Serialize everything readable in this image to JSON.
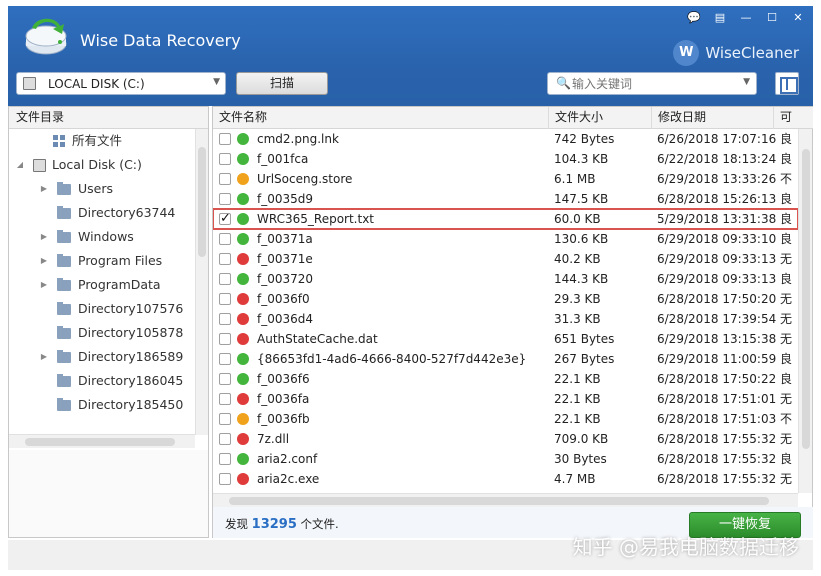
{
  "app": {
    "title": "Wise Data Recovery",
    "brand": "WiseCleaner",
    "brand_mark": "W"
  },
  "window_buttons": [
    "💬",
    "▤",
    "—",
    "☐",
    "✕"
  ],
  "toolbar": {
    "disk": "LOCAL DISK (C:)",
    "scan_label": "扫描",
    "search_placeholder": "输入关键词"
  },
  "sidebar": {
    "header": "文件目录",
    "items": [
      {
        "label": "所有文件",
        "type": "all",
        "indent": 1,
        "expander": ""
      },
      {
        "label": "Local Disk (C:)",
        "type": "disk",
        "indent": 0,
        "expander": "◢"
      },
      {
        "label": "Users",
        "type": "folder",
        "indent": 2,
        "expander": "▶"
      },
      {
        "label": "Directory63744",
        "type": "folder",
        "indent": 2,
        "expander": ""
      },
      {
        "label": "Windows",
        "type": "folder",
        "indent": 2,
        "expander": "▶"
      },
      {
        "label": "Program Files",
        "type": "folder",
        "indent": 2,
        "expander": "▶"
      },
      {
        "label": "ProgramData",
        "type": "folder",
        "indent": 2,
        "expander": "▶"
      },
      {
        "label": "Directory107576",
        "type": "folder",
        "indent": 2,
        "expander": ""
      },
      {
        "label": "Directory105878",
        "type": "folder",
        "indent": 2,
        "expander": ""
      },
      {
        "label": "Directory186589",
        "type": "folder",
        "indent": 2,
        "expander": "▶"
      },
      {
        "label": "Directory186045",
        "type": "folder",
        "indent": 2,
        "expander": ""
      },
      {
        "label": "Directory185450",
        "type": "folder",
        "indent": 2,
        "expander": ""
      }
    ]
  },
  "table": {
    "columns": [
      "文件名称",
      "文件大小",
      "修改日期",
      "可"
    ],
    "rows": [
      {
        "name": "cmd2.png.lnk",
        "size": "742 Bytes",
        "date": "6/26/2018 17:07:16",
        "flag": "良",
        "status": "good",
        "checked": false
      },
      {
        "name": "f_001fca",
        "size": "104.3 KB",
        "date": "6/22/2018 18:13:24",
        "flag": "良",
        "status": "good",
        "checked": false
      },
      {
        "name": "UrlSoceng.store",
        "size": "6.1 MB",
        "date": "6/29/2018 13:33:26",
        "flag": "不",
        "status": "fair",
        "checked": false
      },
      {
        "name": "f_0035d9",
        "size": "147.5 KB",
        "date": "6/28/2018 15:26:13",
        "flag": "良",
        "status": "good",
        "checked": false
      },
      {
        "name": "WRC365_Report.txt",
        "size": "60.0 KB",
        "date": "5/29/2018 13:31:38",
        "flag": "良",
        "status": "good",
        "checked": true
      },
      {
        "name": "f_00371a",
        "size": "130.6 KB",
        "date": "6/29/2018 09:33:10",
        "flag": "良",
        "status": "good",
        "checked": false
      },
      {
        "name": "f_00371e",
        "size": "40.2 KB",
        "date": "6/29/2018 09:33:13",
        "flag": "无",
        "status": "bad",
        "checked": false
      },
      {
        "name": "f_003720",
        "size": "144.3 KB",
        "date": "6/29/2018 09:33:13",
        "flag": "良",
        "status": "good",
        "checked": false
      },
      {
        "name": "f_0036f0",
        "size": "29.3 KB",
        "date": "6/28/2018 17:50:20",
        "flag": "无",
        "status": "bad",
        "checked": false
      },
      {
        "name": "f_0036d4",
        "size": "31.3 KB",
        "date": "6/28/2018 17:39:54",
        "flag": "无",
        "status": "bad",
        "checked": false
      },
      {
        "name": "AuthStateCache.dat",
        "size": "651 Bytes",
        "date": "6/29/2018 13:15:38",
        "flag": "无",
        "status": "bad",
        "checked": false
      },
      {
        "name": "{86653fd1-4ad6-4666-8400-527f7d442e3e}",
        "size": "267 Bytes",
        "date": "6/29/2018 11:00:59",
        "flag": "良",
        "status": "good",
        "checked": false
      },
      {
        "name": "f_0036f6",
        "size": "22.1 KB",
        "date": "6/28/2018 17:50:22",
        "flag": "良",
        "status": "good",
        "checked": false
      },
      {
        "name": "f_0036fa",
        "size": "22.1 KB",
        "date": "6/28/2018 17:51:01",
        "flag": "无",
        "status": "bad",
        "checked": false
      },
      {
        "name": "f_0036fb",
        "size": "22.1 KB",
        "date": "6/28/2018 17:51:03",
        "flag": "不",
        "status": "fair",
        "checked": false
      },
      {
        "name": "7z.dll",
        "size": "709.0 KB",
        "date": "6/28/2018 17:55:32",
        "flag": "无",
        "status": "bad",
        "checked": false
      },
      {
        "name": "aria2.conf",
        "size": "30 Bytes",
        "date": "6/28/2018 17:55:32",
        "flag": "良",
        "status": "good",
        "checked": false
      },
      {
        "name": "aria2c.exe",
        "size": "4.7 MB",
        "date": "6/28/2018 17:55:32",
        "flag": "无",
        "status": "bad",
        "checked": false
      }
    ]
  },
  "footer": {
    "found_prefix": "发现",
    "found_count": "13295",
    "found_suffix": "个文件.",
    "recover_label": "一键恢复"
  },
  "watermark": "知乎 @易我电脑数据迁移",
  "colors": {
    "good": "#44b53c",
    "fair": "#f0a21c",
    "bad": "#e03b3b",
    "accent": "#2a6fc4"
  }
}
